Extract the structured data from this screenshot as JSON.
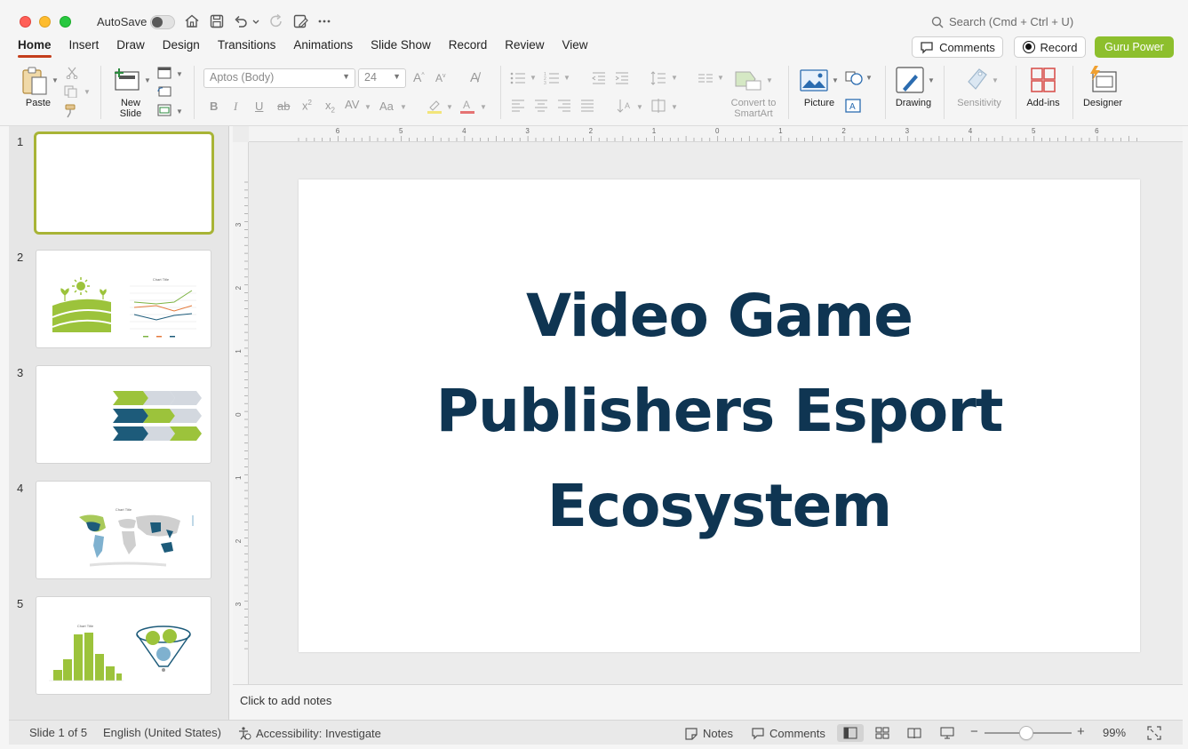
{
  "titlebar": {
    "autosave_label": "AutoSave",
    "search_placeholder": "Search (Cmd + Ctrl + U)"
  },
  "tabs": [
    {
      "label": "Home",
      "active": true
    },
    {
      "label": "Insert"
    },
    {
      "label": "Draw"
    },
    {
      "label": "Design"
    },
    {
      "label": "Transitions"
    },
    {
      "label": "Animations"
    },
    {
      "label": "Slide Show"
    },
    {
      "label": "Record"
    },
    {
      "label": "Review"
    },
    {
      "label": "View"
    }
  ],
  "actions": {
    "comments": "Comments",
    "record": "Record",
    "guru": "Guru Power"
  },
  "ribbon": {
    "paste": "Paste",
    "new_slide": "New\nSlide",
    "font_name": "Aptos (Body)",
    "font_size": "24",
    "convert_smartart": "Convert to\nSmartArt",
    "picture": "Picture",
    "drawing": "Drawing",
    "sensitivity": "Sensitivity",
    "addins": "Add-ins",
    "designer": "Designer"
  },
  "thumbnails": [
    {
      "number": "1"
    },
    {
      "number": "2",
      "chart_title": "Chart Title"
    },
    {
      "number": "3"
    },
    {
      "number": "4",
      "chart_title": "Chart Title"
    },
    {
      "number": "5",
      "chart_title": "Chart Title"
    }
  ],
  "rulers": {
    "h_ticks": [
      "6",
      "5",
      "4",
      "3",
      "2",
      "1",
      "0",
      "1",
      "2",
      "3",
      "4",
      "5",
      "6"
    ],
    "v_ticks": [
      "3",
      "2",
      "1",
      "0",
      "1",
      "2",
      "3"
    ]
  },
  "slide": {
    "title_lines": [
      "Video Game",
      "Publishers Esport",
      "Ecosystem"
    ]
  },
  "notes": {
    "placeholder": "Click to add notes"
  },
  "status": {
    "slide_info": "Slide 1 of 5",
    "language": "English (United States)",
    "accessibility": "Accessibility: Investigate",
    "notes": "Notes",
    "comments": "Comments",
    "zoom": "99%"
  },
  "colors": {
    "accent_green": "#8dbf2d",
    "title_navy": "#0f3552",
    "tab_underline": "#c43e1c",
    "thumb_green": "#9cc33b",
    "thumb_navy": "#1d5b7a"
  }
}
